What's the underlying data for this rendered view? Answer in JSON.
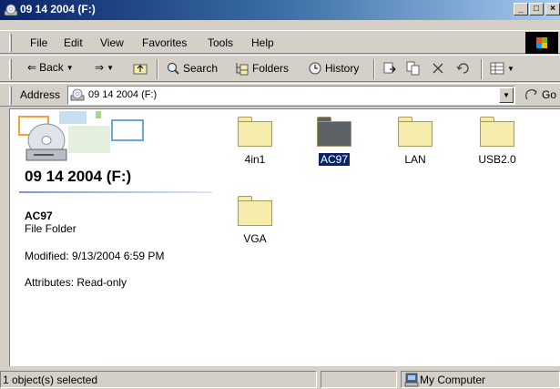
{
  "window": {
    "title": "09 14 2004 (F:)",
    "buttons": {
      "minimize": "_",
      "maximize": "□",
      "close": "×"
    }
  },
  "menu": [
    "File",
    "Edit",
    "View",
    "Favorites",
    "Tools",
    "Help"
  ],
  "toolbar": {
    "back": "Back",
    "search": "Search",
    "folders": "Folders",
    "history": "History"
  },
  "address": {
    "label": "Address",
    "value": "09 14 2004 (F:)",
    "go": "Go"
  },
  "details": {
    "drive_title": "09 14 2004 (F:)",
    "selected_name": "AC97",
    "selected_type": "File Folder",
    "modified": "Modified: 9/13/2004 6:59 PM",
    "attributes": "Attributes: Read-only"
  },
  "folders": [
    {
      "name": "4in1",
      "selected": false
    },
    {
      "name": "AC97",
      "selected": true
    },
    {
      "name": "LAN",
      "selected": false
    },
    {
      "name": "USB2.0",
      "selected": false
    },
    {
      "name": "VGA",
      "selected": false
    }
  ],
  "status": {
    "selection": "1 object(s) selected",
    "zone": "My Computer"
  },
  "colors": {
    "folder": "#f5ecab",
    "folder_selected": "#5c6266",
    "selection": "#0a246a"
  }
}
